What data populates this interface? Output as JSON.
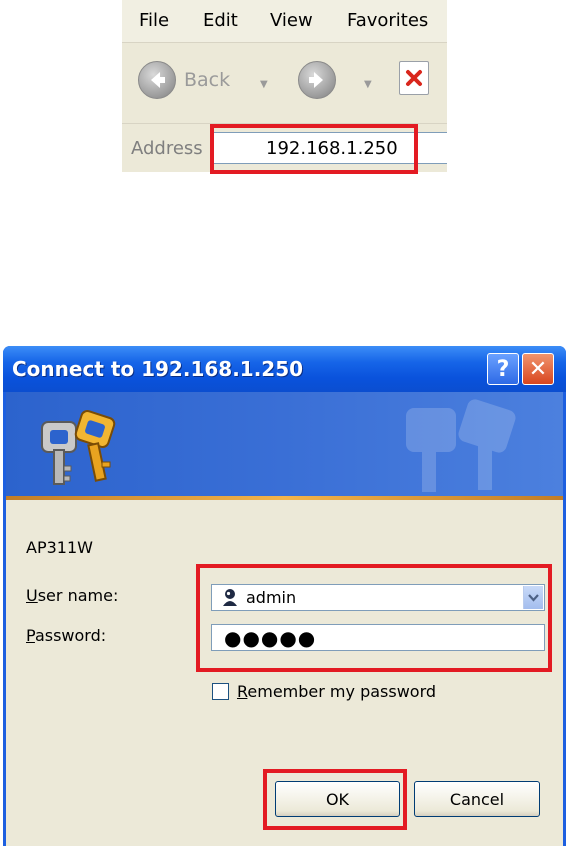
{
  "browser": {
    "menu": [
      "File",
      "Edit",
      "View",
      "Favorites"
    ],
    "toolbar": {
      "back_label": "Back"
    },
    "address": {
      "label": "Address",
      "value": "192.168.1.250"
    }
  },
  "dialog": {
    "title": "Connect to 192.168.1.250",
    "realm": "AP311W",
    "username": {
      "label_access": "U",
      "label_rest": "ser name:",
      "value": "admin"
    },
    "password": {
      "label_access": "P",
      "label_rest": "assword:",
      "value": "●●●●●"
    },
    "remember": {
      "label_access": "R",
      "label_rest": "emember my password",
      "checked": false
    },
    "ok_label": "OK",
    "cancel_label": "Cancel"
  },
  "colors": {
    "highlight": "#e31b23",
    "titlebar": "#0a52dc"
  }
}
